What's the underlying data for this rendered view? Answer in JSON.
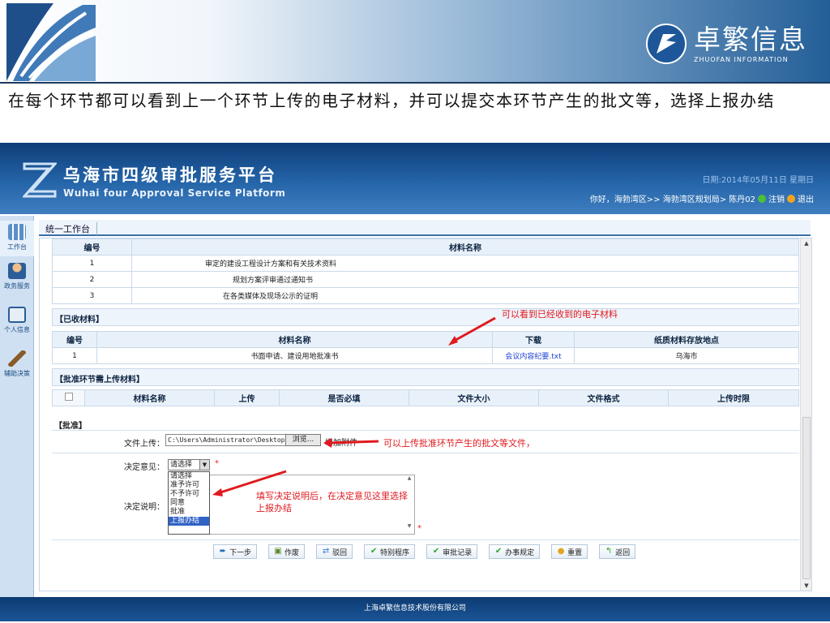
{
  "slide": {
    "brand_cn": "卓繁信息",
    "brand_en": "ZHUOFAN INFORMATION",
    "caption": "在每个环节都可以看到上一个环节上传的电子材料，并可以提交本环节产生的批文等，选择上报办结"
  },
  "app": {
    "title": "乌海市四级审批服务平台",
    "subtitle": "Wuhai four Approval Service Platform",
    "date": "日期:2014年05月11日 星期日",
    "user_greeting": "你好，海勃湾区>> 海勃湾区规划局> 陈丹02",
    "logout": "注销",
    "exit": "退出",
    "footer": "上海卓繁信息技术股份有限公司"
  },
  "sidebar": {
    "items": [
      {
        "label": "工作台",
        "icon": "grid-icon"
      },
      {
        "label": "政务服务",
        "icon": "person-desk-icon"
      },
      {
        "label": "个人信息",
        "icon": "id-card-icon"
      },
      {
        "label": "辅助决策",
        "icon": "gavel-icon"
      }
    ]
  },
  "tabs": {
    "active": "统一工作台"
  },
  "table1": {
    "headers": [
      "编号",
      "材料名称"
    ],
    "rows": [
      [
        "1",
        "审定的建设工程设计方案和有关技术资料"
      ],
      [
        "2",
        "规划方案评审通过通知书"
      ],
      [
        "3",
        "在各类媒体及现场公示的证明"
      ]
    ]
  },
  "received": {
    "title": "【已收材料】",
    "headers": [
      "编号",
      "材料名称",
      "下载",
      "纸质材料存放地点"
    ],
    "rows": [
      [
        "1",
        "书面申请、建设用地批准书",
        "会议内容纪要.txt",
        "乌海市"
      ]
    ]
  },
  "upload_section": {
    "title": "【批准环节需上传材料】",
    "headers": [
      "材料名称",
      "上传",
      "是否必填",
      "文件大小",
      "文件格式",
      "上传时限"
    ]
  },
  "approve": {
    "title": "【批准】",
    "file_label": "文件上传：",
    "file_value": "C:\\Users\\Administrator\\Desktop\\",
    "browse": "浏览...",
    "add_attach": "增加附件",
    "decision_label": "决定意见：",
    "decision_value": "请选择",
    "options": [
      "请选择",
      "准予许可",
      "不予许可",
      "同意",
      "批准",
      "上报办结"
    ],
    "explain_label": "决定说明：",
    "required": "*"
  },
  "actions": [
    "下一步",
    "作废",
    "驳回",
    "特别程序",
    "审批记录",
    "办事规定",
    "重置",
    "返回"
  ],
  "annotations": {
    "a1": "可以看到已经收到的电子材料",
    "a2": "可以上传批准环节产生的批文等文件，",
    "a3": "填写决定说明后，在决定意见这里选择上报办结"
  },
  "colors": {
    "header": "#1f5a9c",
    "annotation": "#e0191e",
    "select_highlight": "#3163c6"
  }
}
